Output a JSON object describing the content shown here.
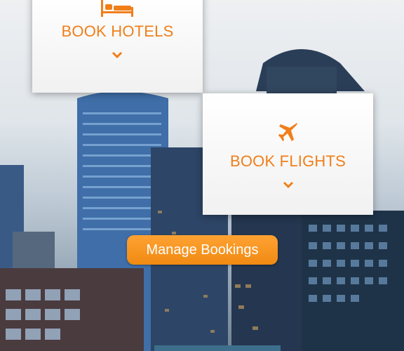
{
  "hotels_card": {
    "label": "BOOK HOTELS",
    "icon": "bed-icon",
    "chevron": "chevron-down-icon"
  },
  "flights_card": {
    "label": "BOOK FLIGHTS",
    "icon": "airplane-icon",
    "chevron": "chevron-down-icon"
  },
  "manage_button": {
    "label": "Manage Bookings"
  },
  "colors": {
    "accent": "#f07f1a",
    "button": "#f5901a",
    "card": "#ffffff"
  }
}
